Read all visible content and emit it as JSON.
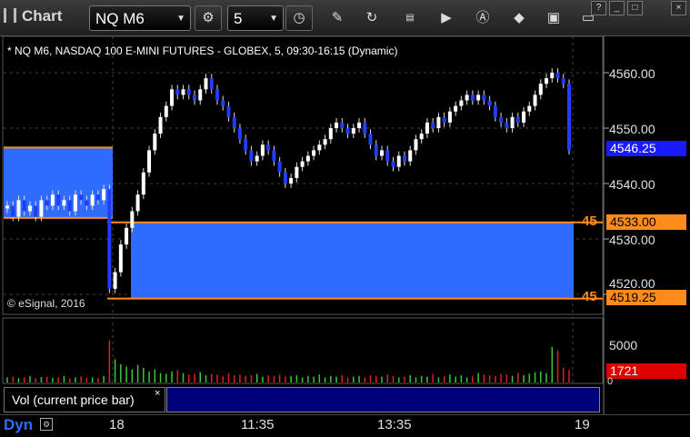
{
  "window": {
    "title": "Chart",
    "symbol": "NQ M6",
    "interval": "5",
    "win_controls": [
      "?",
      "_",
      "□",
      "×"
    ]
  },
  "toolbar_icons": [
    "settings-gear-icon",
    "clock-icon",
    "pencil-draw-icon",
    "refresh-icon",
    "get-data-icon",
    "play-icon",
    "alert-icon",
    "tag-icon",
    "layout-icon",
    "drawer-icon"
  ],
  "chart": {
    "header": "* NQ M6, NASDAQ 100 E-MINI FUTURES - GLOBEX, 5, 09:30-16:15 (Dynamic)",
    "copyright": "© eSignal, 2016",
    "price_axis": [
      "4560.00",
      "4550.00",
      "4540.00",
      "4530.00",
      "4520.00"
    ],
    "last_price": "4546.25",
    "level_high": "4533.00",
    "level_low": "4519.25",
    "level_tag": "45",
    "volume_axis": "5000",
    "volume_last": "1721",
    "volume_zero": "0",
    "volume_panel_label": "Vol (current price bar)",
    "volume_panel_close": "×",
    "x_axis": [
      "18",
      "11:35",
      "13:35",
      "19"
    ],
    "status": "Dyn",
    "colors": {
      "up_candle": "#ffffff",
      "down_candle": "#1f3dff",
      "zone_fill": "#2f6bff",
      "level_line": "#ff8c1a",
      "last_price_box": "#1a1aff",
      "volume_box": "#e00000"
    }
  },
  "chart_data": {
    "type": "candlestick",
    "price_range": [
      4515,
      4565
    ],
    "prices": [
      4536,
      4534,
      4537,
      4535,
      4536,
      4534,
      4537,
      4536,
      4538,
      4536,
      4537,
      4535,
      4538,
      4537,
      4536,
      4538,
      4537,
      4539,
      4521,
      4524,
      4529,
      4532,
      4535,
      4538,
      4542,
      4546,
      4549,
      4552,
      4554,
      4557,
      4556,
      4557,
      4556,
      4555,
      4557,
      4559,
      4557,
      4555,
      4554,
      4552,
      4550,
      4548,
      4546,
      4544,
      4545,
      4547,
      4546,
      4544,
      4542,
      4540,
      4541,
      4543,
      4544,
      4545,
      4546,
      4547,
      4548,
      4550,
      4551,
      4550,
      4549,
      4550,
      4551,
      4549,
      4547,
      4545,
      4546,
      4544,
      4543,
      4545,
      4544,
      4546,
      4548,
      4549,
      4551,
      4550,
      4552,
      4551,
      4553,
      4554,
      4555,
      4556,
      4555,
      4556,
      4555,
      4554,
      4552,
      4551,
      4550,
      4552,
      4551,
      4553,
      4554,
      4556,
      4558,
      4559,
      4560,
      4559,
      4558,
      4546
    ],
    "volumes": [
      700,
      800,
      600,
      700,
      900,
      600,
      750,
      800,
      650,
      700,
      900,
      600,
      700,
      850,
      650,
      700,
      650,
      900,
      5800,
      3200,
      2500,
      2200,
      1800,
      2400,
      2000,
      1500,
      1800,
      1300,
      1200,
      1500,
      1700,
      1300,
      1100,
      1200,
      1400,
      1000,
      1200,
      1100,
      900,
      1300,
      1000,
      1100,
      900,
      1000,
      1200,
      800,
      1000,
      900,
      1100,
      800,
      900,
      1000,
      700,
      900,
      800,
      1100,
      700,
      900,
      800,
      1000,
      700,
      800,
      900,
      700,
      1000,
      900,
      800,
      1100,
      900,
      700,
      800,
      1000,
      700,
      900,
      800,
      1200,
      700,
      900,
      1100,
      800,
      1000,
      700,
      900,
      1300,
      1100,
      1000,
      900,
      1200,
      1100,
      900,
      1300,
      1000,
      1200,
      1400,
      1500,
      1300,
      4900,
      4400,
      2000,
      1721
    ]
  }
}
